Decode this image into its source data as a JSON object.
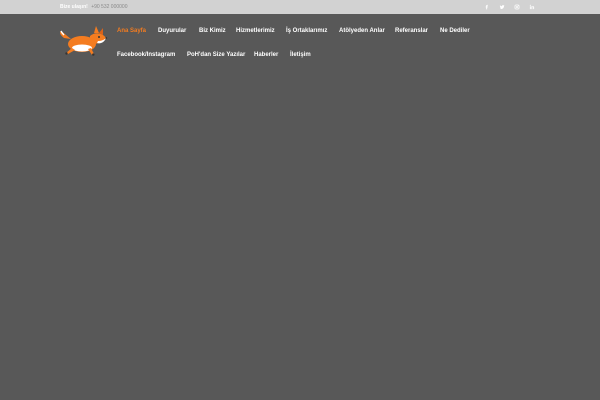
{
  "topbar": {
    "contact_label": "Bize ulaşın!",
    "contact_phone": "+90 532 000000",
    "social": [
      {
        "icon": "facebook-icon",
        "glyph": "f"
      },
      {
        "icon": "twitter-icon",
        "glyph": "t"
      },
      {
        "icon": "instagram-icon",
        "glyph": "ig"
      },
      {
        "icon": "linkedin-icon",
        "glyph": "in"
      }
    ]
  },
  "logo": {
    "icon": "fox-logo-icon"
  },
  "nav": {
    "items": [
      {
        "label": "Ana Sayfa",
        "active": true
      },
      {
        "label": "Duyurular"
      },
      {
        "label": "Biz Kimiz"
      },
      {
        "label": "Hizmetlerimiz"
      },
      {
        "label": "İş Ortaklarımız"
      },
      {
        "label": "Atölyeden Anlar"
      },
      {
        "label": "Referanslar"
      },
      {
        "label": "Ne Dediler"
      },
      {
        "label": "Facebook/Instagram"
      },
      {
        "label": "PoH'dan Size Yazılar"
      },
      {
        "label": "Haberler"
      },
      {
        "label": "İletişim"
      }
    ]
  },
  "colors": {
    "page_background": "#585858",
    "topbar_background": "#d2d2d2",
    "accent": "#f47c20",
    "text": "#ffffff"
  }
}
